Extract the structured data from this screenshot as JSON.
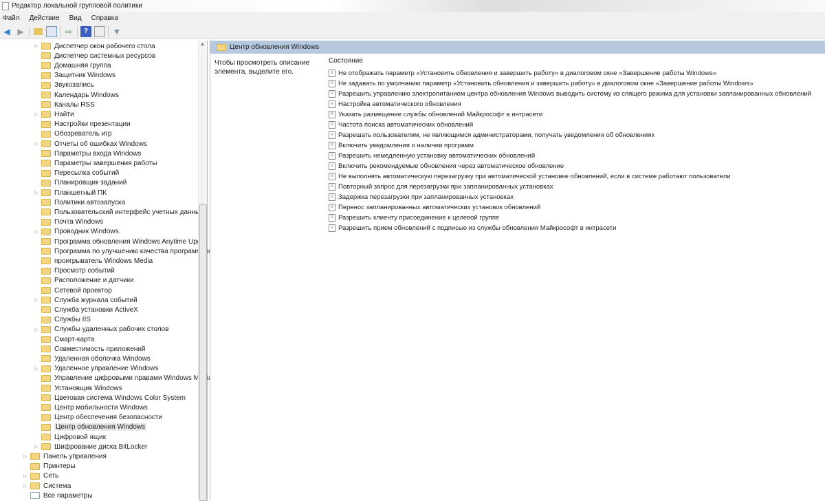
{
  "window": {
    "title": "Редактор локальной групповой политики"
  },
  "menu": [
    "Файл",
    "Действие",
    "Вид",
    "Справка"
  ],
  "toolbar": {
    "icons": [
      "back-arrow-icon",
      "forward-arrow-icon",
      "up-folder-icon",
      "show-hide-tree-icon",
      "export-list-icon",
      "help-icon",
      "show-action-pane-icon",
      "filter-icon"
    ]
  },
  "tree": [
    {
      "label": "Диспетчер окон рабочего стола",
      "level": 2,
      "expandable": true
    },
    {
      "label": "Диспетчер системных ресурсов",
      "level": 2
    },
    {
      "label": "Домашняя группа",
      "level": 2
    },
    {
      "label": "Защитник Windows",
      "level": 2
    },
    {
      "label": "Звукозапись",
      "level": 2
    },
    {
      "label": "Календарь Windows",
      "level": 2
    },
    {
      "label": "Каналы RSS",
      "level": 2
    },
    {
      "label": "Найти",
      "level": 2,
      "expandable": true
    },
    {
      "label": "Настройки презентации",
      "level": 2
    },
    {
      "label": "Обозреватель игр",
      "level": 2
    },
    {
      "label": "Отчеты об ошибках Windows",
      "level": 2,
      "expandable": true
    },
    {
      "label": "Параметры входа Windows",
      "level": 2
    },
    {
      "label": "Параметры завершения работы",
      "level": 2
    },
    {
      "label": "Пересылка событий",
      "level": 2
    },
    {
      "label": "Планировщик заданий",
      "level": 2
    },
    {
      "label": "Планшетный ПК",
      "level": 2,
      "expandable": true
    },
    {
      "label": "Политики автозапуска",
      "level": 2
    },
    {
      "label": "Пользовательский интерфейс учетных данных",
      "level": 2
    },
    {
      "label": "Почта Windows",
      "level": 2
    },
    {
      "label": "Проводник Windows.",
      "level": 2,
      "expandable": true
    },
    {
      "label": "Программа обновления Windows Anytime Upgra",
      "level": 2
    },
    {
      "label": "Программа по улучшению качества программного",
      "level": 2
    },
    {
      "label": "проигрыватель Windows Media",
      "level": 2
    },
    {
      "label": "Просмотр событий",
      "level": 2
    },
    {
      "label": "Расположение и датчики",
      "level": 2
    },
    {
      "label": "Сетевой проектор",
      "level": 2
    },
    {
      "label": "Служба журнала событий",
      "level": 2,
      "expandable": true
    },
    {
      "label": "Служба установки ActiveX",
      "level": 2
    },
    {
      "label": "Службы IIS",
      "level": 2
    },
    {
      "label": "Службы удаленных рабочих столов",
      "level": 2,
      "expandable": true
    },
    {
      "label": "Смарт-карта",
      "level": 2
    },
    {
      "label": "Совместимость приложений",
      "level": 2
    },
    {
      "label": "Удаленная оболочка Windows",
      "level": 2
    },
    {
      "label": "Удаленное управление Windows",
      "level": 2,
      "expandable": true
    },
    {
      "label": "Управление цифровыми правами Windows Media",
      "level": 2
    },
    {
      "label": "Установщик Windows",
      "level": 2
    },
    {
      "label": "Цветовая система Windows Color System",
      "level": 2
    },
    {
      "label": "Центр мобильности Windows",
      "level": 2
    },
    {
      "label": "Центр обеспечения безопасности",
      "level": 2
    },
    {
      "label": "Центр обновления Windows",
      "level": 2,
      "selected": true
    },
    {
      "label": "Цифровой ящик",
      "level": 2
    },
    {
      "label": "Шифрование диска BitLocker",
      "level": 2,
      "expandable": true
    },
    {
      "label": "Панель управления",
      "level": 1,
      "expandable": true
    },
    {
      "label": "Принтеры",
      "level": 1
    },
    {
      "label": "Сеть",
      "level": 1,
      "expandable": true
    },
    {
      "label": "Система",
      "level": 1,
      "expandable": true
    },
    {
      "label": "Все параметры",
      "level": 1,
      "allsettings": true
    }
  ],
  "right": {
    "header": "Центр обновления Windows",
    "description": "Чтобы просмотреть описание элемента, выделите его.",
    "column": "Состояние",
    "items": [
      "Не отображать параметр «Установить обновления и завершить работу» в диалоговом окне «Завершение работы Windows»",
      "Не задавать по умолчанию параметр «Установить обновления и завершить работу» в диалоговом окне «Завершение работы Windows»",
      "Разрешить управлению электропитанием центра обновления Windows выводить систему из спящего режима для установки запланированных обновлений",
      "Настройка автоматического обновления",
      "Указать размещение службы обновлений Майкрософт в интрасети",
      "Частота поиска автоматических обновлений",
      "Разрешать пользователям, не являющимся администраторами, получать уведомления об обновлениях",
      "Включить уведомления о наличии программ",
      "Разрешить немедленную установку автоматических обновлений",
      "Включить рекомендуемые обновления через автоматическое обновление",
      "Не выполнять автоматическую перезагрузку при автоматической установке обновлений, если в системе работают пользователи",
      "Повторный запрос для перезагрузки при запланированных установках",
      "Задержка перезагрузки при запланированных установках",
      "Перенос запланированных автоматических установок обновлений",
      "Разрешить клиенту присоединение к целевой группе",
      "Разрешить прием обновлений с подписью из службы обновления Майкрософт в интрасети"
    ]
  }
}
